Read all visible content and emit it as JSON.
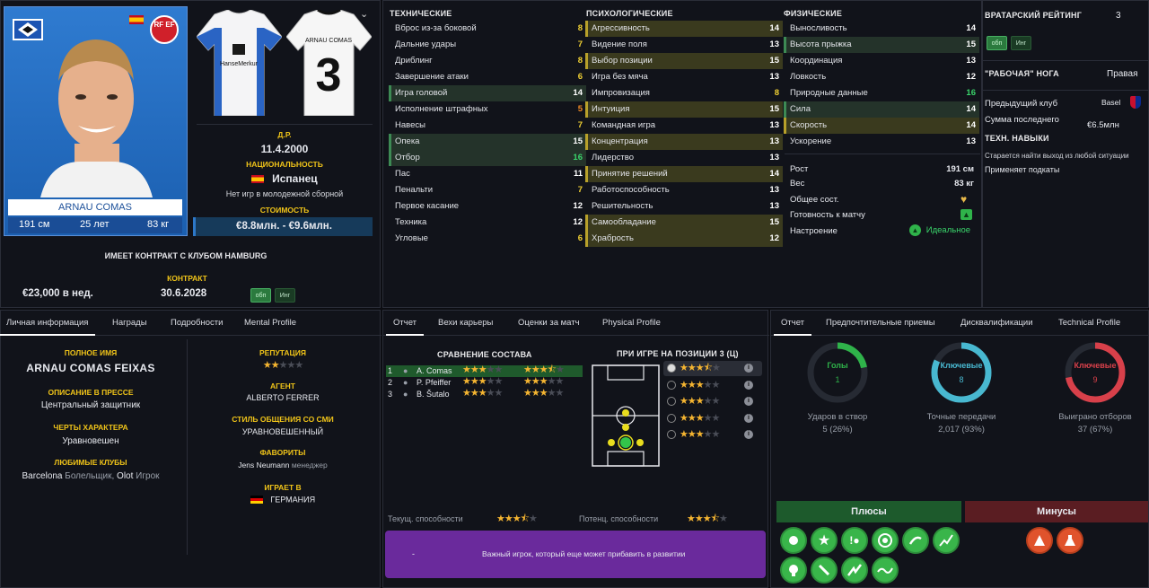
{
  "player": {
    "name_card": "ARNAU COMAS",
    "height": "191 см",
    "age": "25 лет",
    "weight": "83 кг",
    "dob_label": "Д.Р.",
    "dob": "11.4.2000",
    "nationality_label": "НАЦИОНАЛЬНОСТЬ",
    "nationality": "Испанец",
    "youth_note": "Нет игр в молодежной сборной",
    "value_label": "СТОИМОСТЬ",
    "value": "€8.8млн. - €9.6млн.",
    "contract_header": "ИМЕЕТ КОНТРАКТ С КЛУБОМ HAMBURG",
    "contract_label": "КОНТРАКТ",
    "wage": "€23,000 в нед.",
    "contract_end": "30.6.2028",
    "fed_badge": "RF EF",
    "tag_obp": "обп",
    "tag_ing": "Инг",
    "shirt_back_name": "ARNAU COMAS",
    "shirt_back_number": "3",
    "shirt_sponsor": "HanseMerkur"
  },
  "technical": {
    "title": "ТЕХНИЧЕСКИЕ",
    "rows": [
      {
        "label": "Вброс из-за боковой",
        "value": "8"
      },
      {
        "label": "Дальние удары",
        "value": "7"
      },
      {
        "label": "Дриблинг",
        "value": "8"
      },
      {
        "label": "Завершение атаки",
        "value": "6"
      },
      {
        "label": "Игра головой",
        "value": "14"
      },
      {
        "label": "Исполнение штрафных",
        "value": "5"
      },
      {
        "label": "Навесы",
        "value": "7"
      },
      {
        "label": "Опека",
        "value": "15"
      },
      {
        "label": "Отбор",
        "value": "16"
      },
      {
        "label": "Пас",
        "value": "11"
      },
      {
        "label": "Пенальти",
        "value": "7"
      },
      {
        "label": "Первое касание",
        "value": "12"
      },
      {
        "label": "Техника",
        "value": "12"
      },
      {
        "label": "Угловые",
        "value": "6"
      }
    ]
  },
  "mental": {
    "title": "ПСИХОЛОГИЧЕСКИЕ",
    "rows": [
      {
        "label": "Агрессивность",
        "value": "14"
      },
      {
        "label": "Видение поля",
        "value": "13"
      },
      {
        "label": "Выбор позиции",
        "value": "15"
      },
      {
        "label": "Игра без мяча",
        "value": "13"
      },
      {
        "label": "Импровизация",
        "value": "8"
      },
      {
        "label": "Интуиция",
        "value": "15"
      },
      {
        "label": "Командная игра",
        "value": "13"
      },
      {
        "label": "Концентрация",
        "value": "13"
      },
      {
        "label": "Лидерство",
        "value": "13"
      },
      {
        "label": "Принятие решений",
        "value": "14"
      },
      {
        "label": "Работоспособность",
        "value": "13"
      },
      {
        "label": "Решительность",
        "value": "13"
      },
      {
        "label": "Самообладание",
        "value": "15"
      },
      {
        "label": "Храбрость",
        "value": "12"
      }
    ]
  },
  "physical": {
    "title": "ФИЗИЧЕСКИЕ",
    "rows": [
      {
        "label": "Выносливость",
        "value": "14"
      },
      {
        "label": "Высота прыжка",
        "value": "15"
      },
      {
        "label": "Координация",
        "value": "13"
      },
      {
        "label": "Ловкость",
        "value": "12"
      },
      {
        "label": "Природные данные",
        "value": "16"
      },
      {
        "label": "Сила",
        "value": "14"
      },
      {
        "label": "Скорость",
        "value": "14"
      },
      {
        "label": "Ускорение",
        "value": "13"
      }
    ],
    "height_label": "Рост",
    "height": "191 см",
    "weight_label": "Вес",
    "weight": "83 кг",
    "condition_label": "Общее сост.",
    "readiness_label": "Готовность к матчу",
    "morale_label": "Настроение",
    "morale": "Идеальное"
  },
  "side": {
    "gk_label": "ВРАТАРСКИЙ РЕЙТИНГ",
    "gk_value": "3",
    "foot_label": "\"РАБОЧАЯ\" НОГА",
    "foot_value": "Правая",
    "prev_club_label": "Предыдущий клуб",
    "prev_club": "Basel",
    "last_fee_label": "Сумма последнего",
    "last_fee": "€6.5млн",
    "skills_label": "ТЕХН. НАВЫКИ",
    "skill1": "Старается найти выход из любой ситуации",
    "skill2": "Применяет подкаты"
  },
  "left_tabs": [
    "Личная информация",
    "Награды",
    "Подробности",
    "Mental Profile"
  ],
  "personal": {
    "full_name_label": "ПОЛНОЕ ИМЯ",
    "full_name": "ARNAU COMAS FEIXAS",
    "press_label": "ОПИСАНИЕ В ПРЕССЕ",
    "press": "Центральный защитник",
    "traits_label": "ЧЕРТЫ ХАРАКТЕРА",
    "traits": "Уравновешен",
    "clubs_label": "ЛЮБИМЫЕ КЛУБЫ",
    "club1": "Barcelona",
    "club1_role": "Болельщик,",
    "club2": "Olot",
    "club2_role": "Игрок",
    "rep_label": "РЕПУТАЦИЯ",
    "reputation_stars": 2,
    "agent_label": "АГЕНТ",
    "agent": "ALBERTO FERRER",
    "media_label": "СТИЛЬ ОБЩЕНИЯ СО СМИ",
    "media": "УРАВНОВЕШЕННЫЙ",
    "fav_label": "ФАВОРИТЫ",
    "fav": "Jens Neumann",
    "fav_role": "менеджер",
    "plays_label": "ИГРАЕТ В",
    "plays": "ГЕРМАНИЯ"
  },
  "mid_tabs": [
    "Отчет",
    "Вехи карьеры",
    "Оценки за матч",
    "Physical Profile"
  ],
  "report": {
    "compare_title": "СРАВНЕНИЕ СОСТАВА",
    "players": [
      {
        "rank": "1",
        "name": "A. Comas",
        "s1": 3,
        "s2": 3.5
      },
      {
        "rank": "2",
        "name": "P. Pfeiffer",
        "s1": 3,
        "s2": 3
      },
      {
        "rank": "3",
        "name": "B. Šutalo",
        "s1": 3,
        "s2": 3
      }
    ],
    "position_title": "ПРИ ИГРЕ НА ПОЗИЦИИ 3 (Ц)",
    "position_stars": [
      3.5,
      3,
      3,
      3,
      3
    ],
    "current_label": "Текущ. способности",
    "current_stars": 3.5,
    "potential_label": "Потенц. способности",
    "potential_stars": 3.5,
    "banner_dash": "-",
    "banner_text": "Важный игрок, который еще может прибавить в развитии"
  },
  "right_tabs": [
    "Отчет",
    "Предпочтительные приемы",
    "Дисквалификации",
    "Technical Profile"
  ],
  "rings": [
    {
      "title": "Голы",
      "value": "1",
      "label": "Ударов в створ",
      "stat": "5 (26%)",
      "color": "#2fb34a"
    },
    {
      "title": "Ключевые",
      "value": "8",
      "label": "Точные передачи",
      "stat": "2,017 (93%)",
      "color": "#48b8d0"
    },
    {
      "title": "Ключевые",
      "value": "9",
      "label": "Выиграно отборов",
      "stat": "37 (67%)",
      "color": "#d8404a"
    }
  ],
  "pros_label": "Плюсы",
  "cons_label": "Минусы",
  "colors": {
    "accent_green": "#3ad56b",
    "accent_yellow": "#f0c419",
    "banner": "#6a2a9c"
  }
}
